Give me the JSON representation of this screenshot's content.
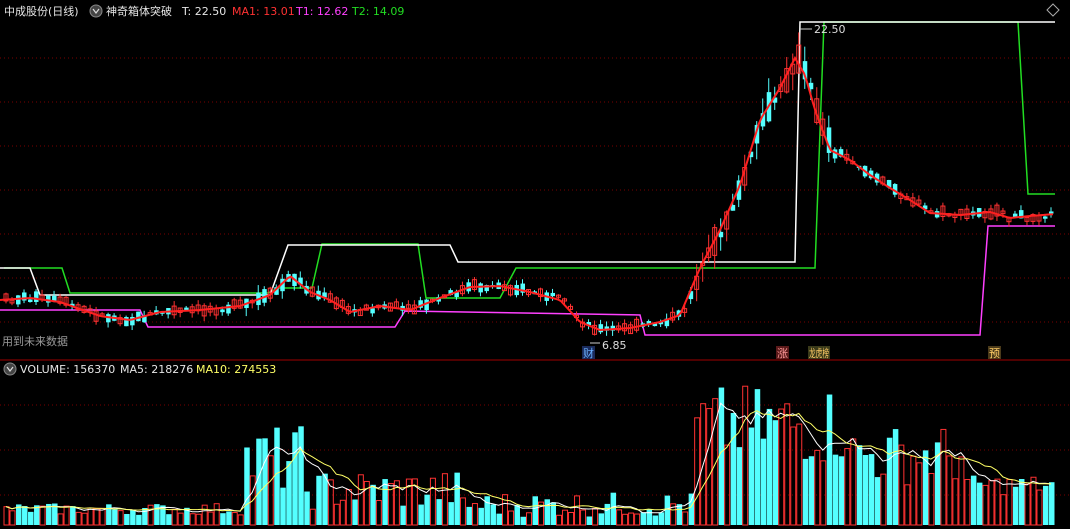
{
  "price_header": {
    "stock": "中成股份(日线)",
    "indicator": "神奇箱体突破",
    "t_label": "T: 22.50",
    "ma1_label": "MA1: 13.01",
    "t1_label": "T1: 12.62",
    "t2_label": "T2: 14.09"
  },
  "volume_header": {
    "volume_label": "VOLUME: 156370",
    "ma5_label": "MA5: 218276",
    "ma10_label": "MA10: 274553"
  },
  "annotations": {
    "future_data": "用到未来数据",
    "high_label": "22.50",
    "low_label": "6.85",
    "marker_cai": "财",
    "marker_zhang": "涨",
    "marker_bang": "龙虎榜",
    "marker_yu": "预"
  },
  "colors": {
    "up": "#ff3232",
    "down": "#54ffff",
    "ma1": "#ff2020",
    "t_line": "#ffffff",
    "t1_line": "#ff40ff",
    "t2_line": "#22dd22",
    "vol_ma5": "#ffffff",
    "vol_ma10": "#ffff66",
    "grid": "#7a0000"
  },
  "chart_data": [
    {
      "type": "candlestick",
      "series": [
        {
          "name": "T",
          "value": 22.5
        },
        {
          "name": "MA1",
          "value": 13.01
        },
        {
          "name": "T1",
          "value": 12.62
        },
        {
          "name": "T2",
          "value": 14.09
        }
      ],
      "high": 22.5,
      "low": 6.85
    },
    {
      "type": "bar",
      "series": [
        {
          "name": "VOLUME",
          "value": 156370
        },
        {
          "name": "MA5",
          "value": 218276
        },
        {
          "name": "MA10",
          "value": 274553
        }
      ]
    }
  ]
}
